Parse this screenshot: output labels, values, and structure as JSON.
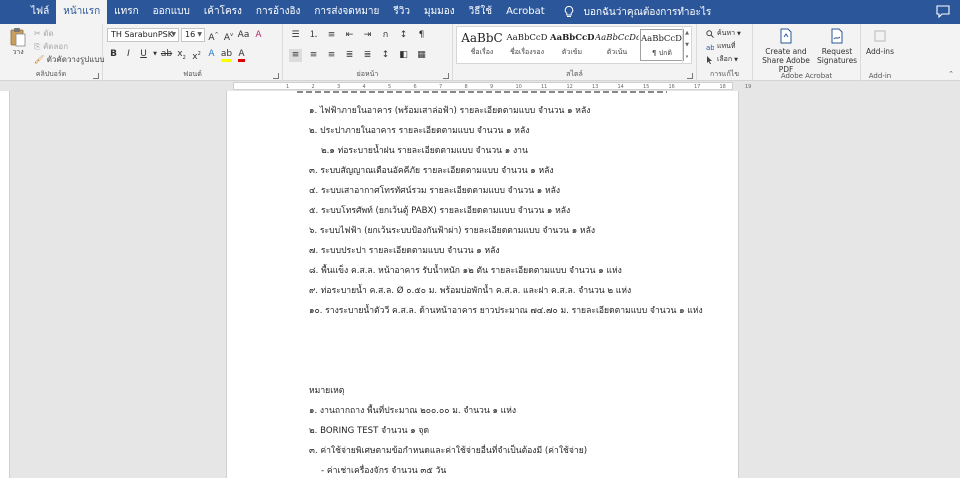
{
  "tabs": [
    {
      "label": "ไฟล์",
      "active": false
    },
    {
      "label": "หน้าแรก",
      "active": true
    },
    {
      "label": "แทรก",
      "active": false
    },
    {
      "label": "ออกแบบ",
      "active": false
    },
    {
      "label": "เค้าโครง",
      "active": false
    },
    {
      "label": "การอ้างอิง",
      "active": false
    },
    {
      "label": "การส่งจดหมาย",
      "active": false
    },
    {
      "label": "รีวิว",
      "active": false
    },
    {
      "label": "มุมมอง",
      "active": false
    },
    {
      "label": "วิธีใช้",
      "active": false
    },
    {
      "label": "Acrobat",
      "active": false
    }
  ],
  "tell_me": "บอกฉันว่าคุณต้องการทำอะไร",
  "icons": {
    "tell_me": "lightbulb-icon",
    "comment": "comment-icon",
    "paste": "clipboard-icon",
    "find": "search-icon",
    "replace": "replace-icon",
    "select": "cursor-icon"
  },
  "clipboard": {
    "paste": "วาง",
    "cut": "ตัด",
    "copy": "คัดลอก",
    "format_painter": "ตัวคัดวางรูปแบบ",
    "group_label": "คลิปบอร์ด"
  },
  "font": {
    "name": "TH SarabunPSK",
    "size": "16",
    "group_label": "ฟอนต์"
  },
  "paragraph": {
    "group_label": "ย่อหน้า"
  },
  "styles": {
    "items": [
      {
        "sample": "AaBbC",
        "name": "ชื่อเรื่อง"
      },
      {
        "sample": "AaBbCcD",
        "name": "ชื่อเรื่องรอง"
      },
      {
        "sample": "AaBbCcDd",
        "name": "ตัวเข้ม"
      },
      {
        "sample": "AaBbCcDc",
        "name": "ตัวเน้น"
      },
      {
        "sample": "AaBbCcDd",
        "name": "¶ ปกติ"
      }
    ],
    "group_label": "สไตล์"
  },
  "editing": {
    "find": "ค้นหา",
    "replace": "แทนที่",
    "select": "เลือก",
    "group_label": "การแก้ไข"
  },
  "acrobat": {
    "create_share": "Create and Share Adobe PDF",
    "request_sig": "Request Signatures",
    "group_label": "Adobe Acrobat"
  },
  "addin": {
    "label": "Add-ins",
    "group_label": "Add-in"
  },
  "ruler_ticks": [
    "1",
    "2",
    "3",
    "4",
    "5",
    "6",
    "7",
    "8",
    "9",
    "10",
    "11",
    "12",
    "13",
    "14",
    "15",
    "16",
    "17",
    "18",
    "19"
  ],
  "document": {
    "lines": [
      {
        "text": "๑. ไฟฟ้าภายในอาคาร (พร้อมเสาล่อฟ้า) รายละเอียดตามแบบ จำนวน ๑ หลัง",
        "indent": false
      },
      {
        "text": "๒. ประปาภายในอาคาร รายละเอียดตามแบบ จำนวน ๑ หลัง",
        "indent": false
      },
      {
        "text": "๒.๑ ท่อระบายน้ำฝน รายละเอียดตามแบบ จำนวน ๑ งาน",
        "indent": true
      },
      {
        "text": "๓. ระบบสัญญาณเตือนอัคคีภัย รายละเอียดตามแบบ จำนวน ๑ หลัง",
        "indent": false
      },
      {
        "text": "๔. ระบบเสาอากาศโทรทัศน์รวม รายละเอียดตามแบบ จำนวน ๑ หลัง",
        "indent": false
      },
      {
        "text": "๕. ระบบโทรศัพท์ (ยกเว้นตู้ PABX) รายละเอียดตามแบบ จำนวน ๑ หลัง",
        "indent": false
      },
      {
        "text": "๖. ระบบไฟฟ้า (ยกเว้นระบบป้องกันฟ้าผ่า) รายละเอียดตามแบบ จำนวน ๑ หลัง",
        "indent": false
      },
      {
        "text": "๗. ระบบประปา รายละเอียดตามแบบ จำนวน ๑ หลัง",
        "indent": false
      },
      {
        "text": "๘. พื้นแข็ง ค.ส.ล. หน้าอาคาร รับน้ำหนัก ๑๒ ตัน รายละเอียดตามแบบ จำนวน ๑ แห่ง",
        "indent": false
      },
      {
        "text": "๙. ท่อระบายน้ำ ค.ส.ล. Ø ๐.๕๐ ม. พร้อมบ่อพักน้ำ ค.ส.ล. และฝา ค.ส.ล. จำนวน ๒ แห่ง",
        "indent": false
      },
      {
        "text": "๑๐. รางระบายน้ำตัววี ค.ส.ล. ด้านหน้าอาคาร ยาวประมาณ ๗๔.๗๐ ม. รายละเอียดตามแบบ  จำนวน ๑ แห่ง",
        "indent": false
      }
    ],
    "notes_title": "หมายเหตุ",
    "notes": [
      {
        "text": "๑. งานถากถาง พื้นที่ประมาณ ๒๐๐.๐๐ ม. จำนวน ๑ แห่ง",
        "indent": false
      },
      {
        "text": "๒. BORING TEST จำนวน ๑ จุด",
        "indent": false
      },
      {
        "text": "๓. ค่าใช้จ่ายพิเศษตามข้อกำหนดและค่าใช้จ่ายอื่นที่จำเป็นต้องมี (ค่าใช้จ่าย)",
        "indent": false
      },
      {
        "text": "- ค่าเช่าเครื่องจักร จำนวน ๓๕ วัน",
        "indent": true
      }
    ]
  }
}
